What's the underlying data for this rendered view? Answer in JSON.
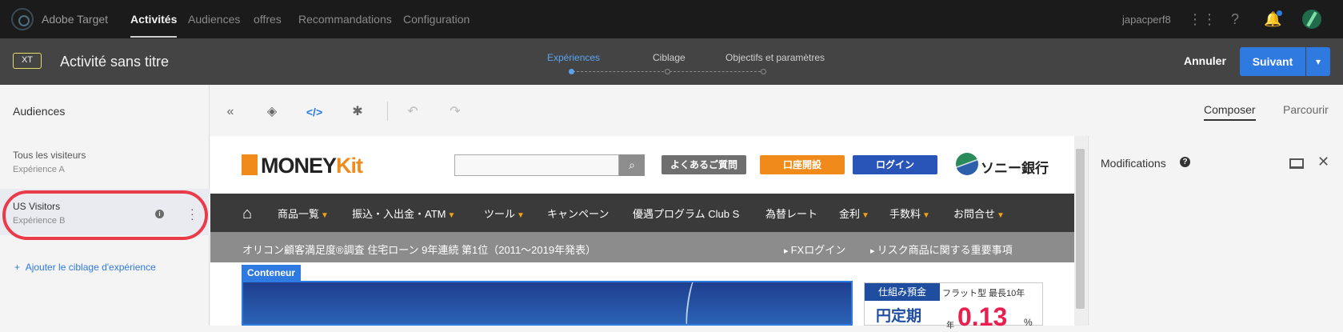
{
  "topnav": {
    "app_name": "Adobe Target",
    "items": [
      "Activités",
      "Audiences",
      "offres",
      "Recommandations",
      "Configuration"
    ],
    "active_index": 0,
    "username": "japacperf8"
  },
  "activity_bar": {
    "badge": "XT",
    "title": "Activité sans titre",
    "steps": [
      "Expériences",
      "Ciblage",
      "Objectifs et paramètres"
    ],
    "active_step": 0,
    "cancel_label": "Annuler",
    "next_label": "Suivant"
  },
  "left_panel": {
    "title": "Audiences",
    "audiences": [
      {
        "name": "Tous les visiteurs",
        "experience": "Expérience A"
      },
      {
        "name": "US Visitors",
        "experience": "Expérience B"
      }
    ],
    "selected_index": 1,
    "add_label": "Ajouter le ciblage d'expérience"
  },
  "toolbar": {
    "compose_label": "Composer",
    "browse_label": "Parcourir"
  },
  "preview": {
    "logo_text_a": "MONEY",
    "logo_text_b": "Kit",
    "buttons": {
      "faq": "よくあるご質問",
      "open_account": "口座開設",
      "login": "ログイン"
    },
    "bank_name": "ソニー銀行",
    "nav_items": [
      "商品一覧",
      "振込・入出金・ATM",
      "ツール",
      "キャンペーン",
      "優遇プログラム Club S",
      "為替レート",
      "金利",
      "手数料",
      "お問合せ"
    ],
    "sub_text": "オリコン顧客満足度®調査 住宅ローン 9年連続 第1位（2011〜2019年発表）",
    "sub_links": [
      "FXログイン",
      "リスク商品に関する重要事項"
    ],
    "container_label": "Conteneur",
    "rate_header_left": "仕組み預金",
    "rate_header_right": "フラット型 最長10年",
    "rate_name": "円定期",
    "rate_prefix": "年",
    "rate_value": "0.13",
    "rate_unit": "%"
  },
  "right_panel": {
    "title": "Modifications"
  },
  "colors": {
    "accent": "#2f7ae0",
    "highlight_ring": "#ea3b4a",
    "brand_orange": "#f08b1b"
  }
}
